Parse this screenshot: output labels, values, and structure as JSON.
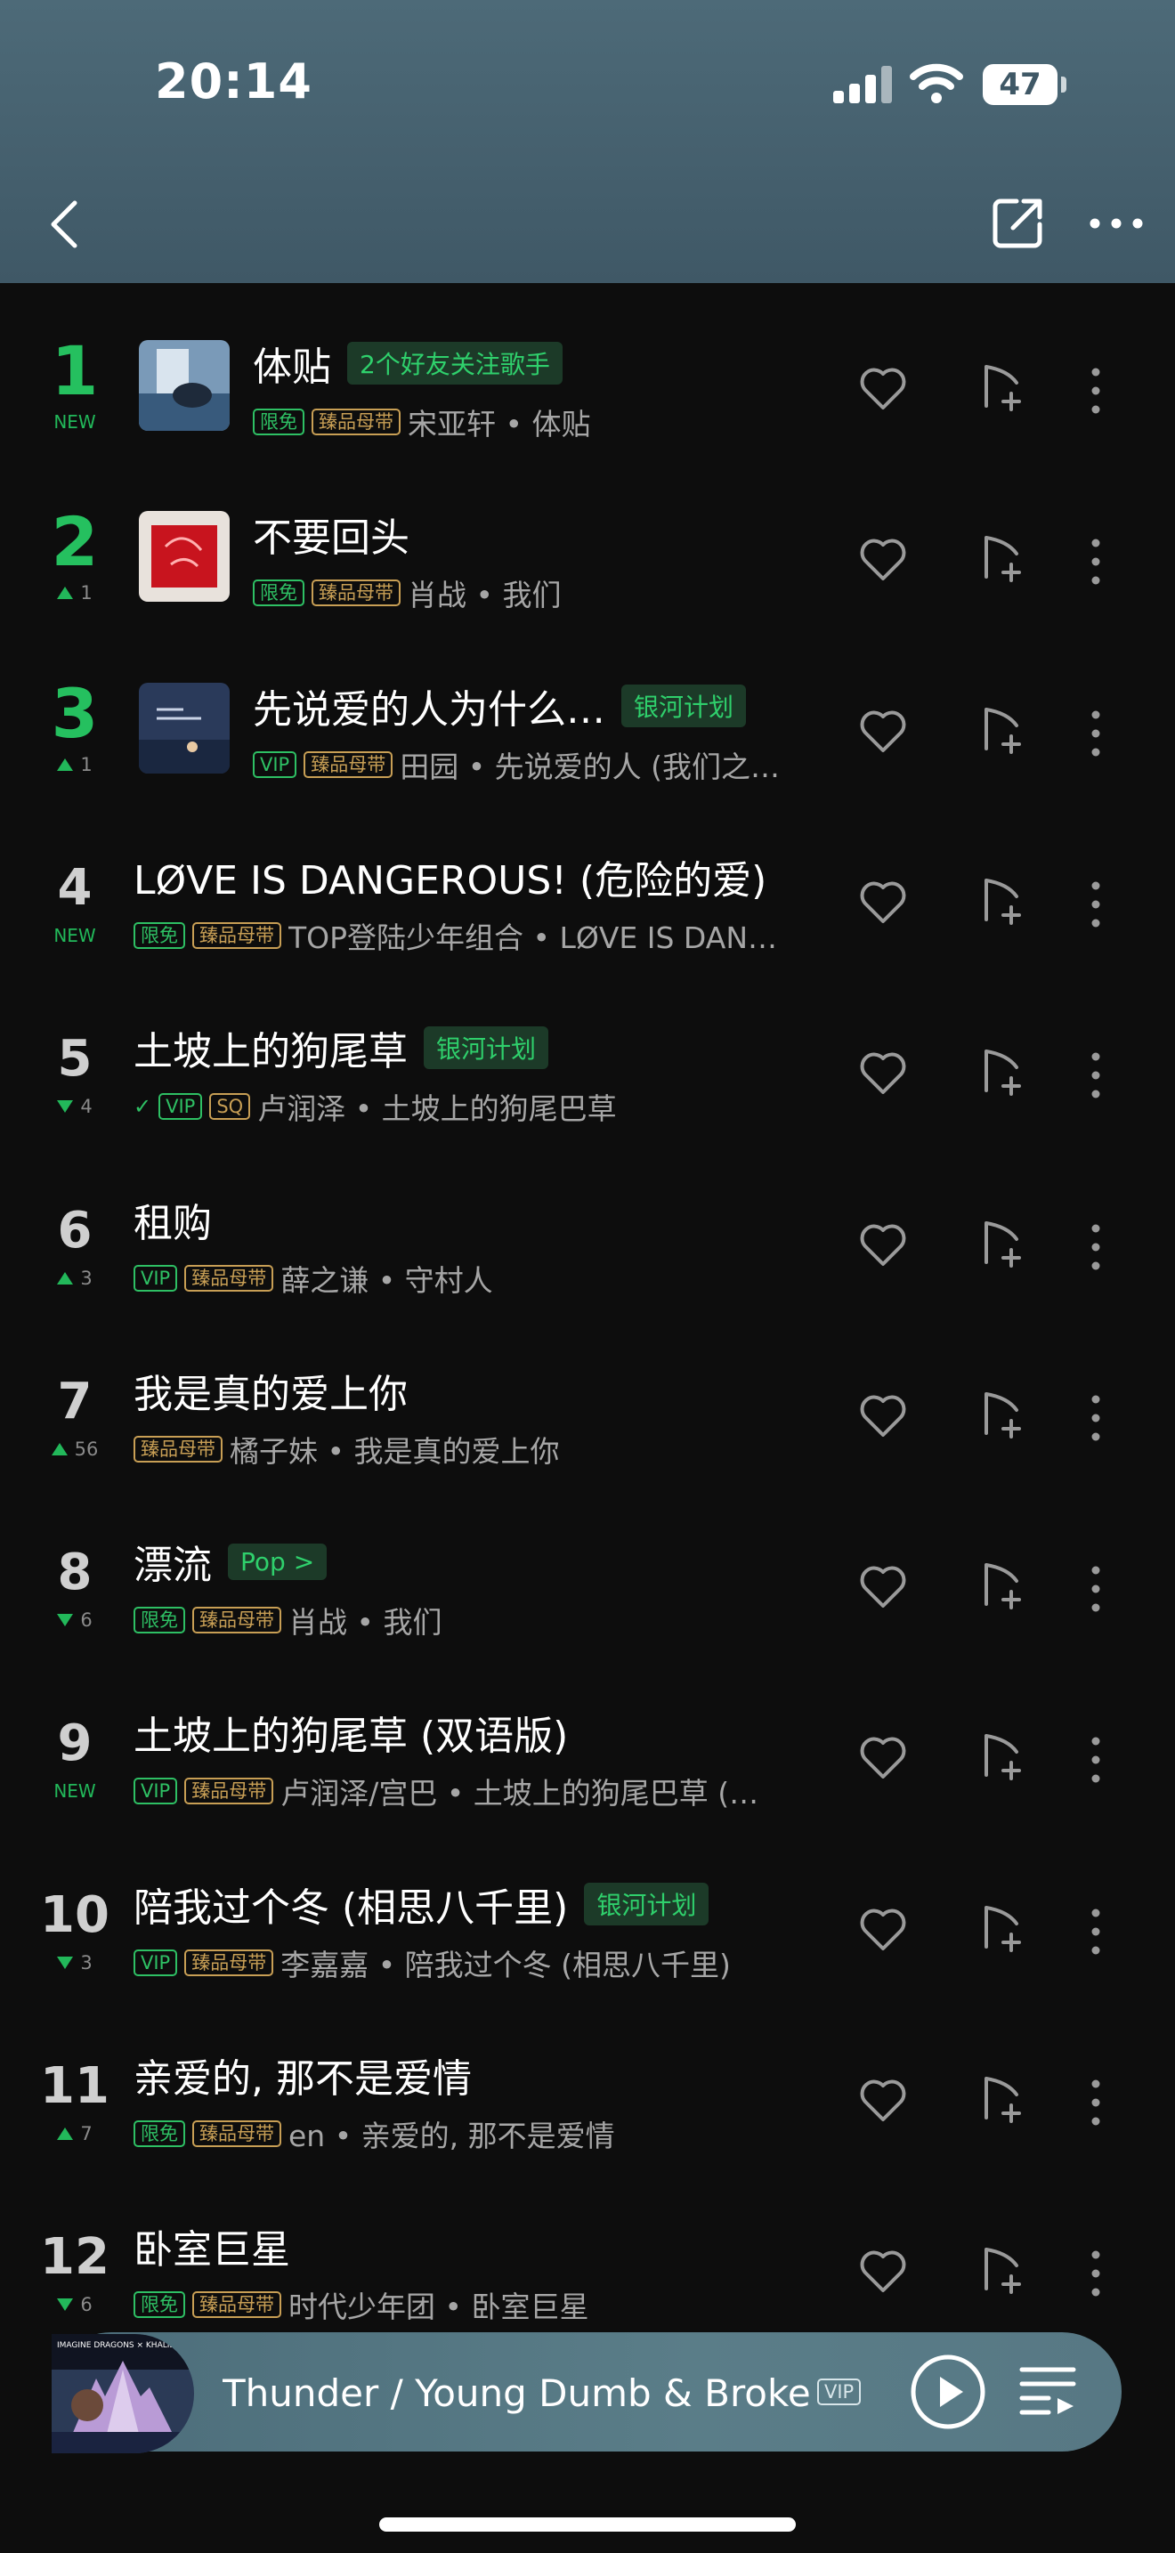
{
  "status_bar": {
    "time": "20:14",
    "battery": "47"
  },
  "colors": {
    "accent_green": "#25c05f",
    "header_bg": "#4d6a78",
    "badge_gold": "#c89f55"
  },
  "header": {
    "back_icon": "chevron-left-icon",
    "share_icon": "share-icon",
    "more_icon": "more-icon"
  },
  "songs": [
    {
      "rank": "1",
      "change": "NEW",
      "title": "体贴",
      "tag": "2个好友关注歌手",
      "badges": [
        "限免",
        "臻品母带"
      ],
      "meta": "宋亚轩 • 体贴"
    },
    {
      "rank": "2",
      "change": "1",
      "title": "不要回头",
      "tag": "",
      "badges": [
        "限免",
        "臻品母带"
      ],
      "meta": "肖战 • 我们"
    },
    {
      "rank": "3",
      "change": "1",
      "title": "先说爱的人为什么…",
      "tag": "银河计划",
      "badges": [
        "VIP",
        "臻品母带"
      ],
      "meta": "田园 • 先说爱的人 (我们之…"
    },
    {
      "rank": "4",
      "change": "NEW",
      "title": "LØVE IS DANGEROUS! (危险的爱)",
      "tag": "",
      "badges": [
        "限免",
        "臻品母带"
      ],
      "meta": "TOP登陆少年组合 • LØVE IS DAN…"
    },
    {
      "rank": "5",
      "change": "4",
      "title": "土坡上的狗尾草",
      "tag": "银河计划",
      "badges": [
        "VIP",
        "SQ"
      ],
      "meta": "卢润泽 • 土坡上的狗尾巴草"
    },
    {
      "rank": "6",
      "change": "3",
      "title": "租购",
      "tag": "",
      "badges": [
        "VIP",
        "臻品母带"
      ],
      "meta": "薛之谦 • 守村人"
    },
    {
      "rank": "7",
      "change": "56",
      "title": "我是真的爱上你",
      "tag": "",
      "badges": [
        "臻品母带"
      ],
      "meta": "橘子妹 • 我是真的爱上你"
    },
    {
      "rank": "8",
      "change": "6",
      "title": "漂流",
      "tag": "Pop >",
      "badges": [
        "限免",
        "臻品母带"
      ],
      "meta": "肖战 • 我们"
    },
    {
      "rank": "9",
      "change": "NEW",
      "title": "土坡上的狗尾草 (双语版)",
      "tag": "",
      "badges": [
        "VIP",
        "臻品母带"
      ],
      "meta": "卢润泽/宫巴 • 土坡上的狗尾巴草 (…"
    },
    {
      "rank": "10",
      "change": "3",
      "title": "陪我过个冬 (相思八千里)",
      "tag": "银河计划",
      "badges": [
        "VIP",
        "臻品母带"
      ],
      "meta": "李嘉嘉 • 陪我过个冬 (相思八千里)"
    },
    {
      "rank": "11",
      "change": "7",
      "title": "亲爱的, 那不是爱情",
      "tag": "",
      "badges": [
        "限免",
        "臻品母带"
      ],
      "meta": "en • 亲爱的, 那不是爱情"
    },
    {
      "rank": "12",
      "change": "6",
      "title": "卧室巨星",
      "tag": "",
      "badges": [
        "限免",
        "臻品母带"
      ],
      "meta": "时代少年团 • 卧室巨星"
    }
  ],
  "player": {
    "art_caption": "IMAGINE DRAGONS × KHALID",
    "title": "Thunder / Young Dumb & Broke (",
    "badge": "VIP",
    "play_icon": "play-icon",
    "queue_icon": "playlist-icon"
  }
}
